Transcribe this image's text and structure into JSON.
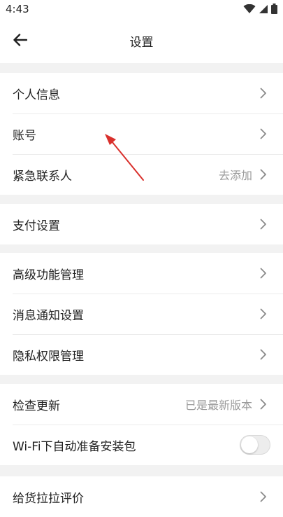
{
  "status_bar": {
    "time": "4:43",
    "icons": [
      "wifi-icon",
      "signal-icon",
      "battery-icon"
    ]
  },
  "header": {
    "title": "设置",
    "back_icon": "back-arrow-icon"
  },
  "groups": [
    {
      "items": [
        {
          "label": "个人信息",
          "value": "",
          "control": "chevron"
        },
        {
          "label": "账号",
          "value": "",
          "control": "chevron"
        },
        {
          "label": "紧急联系人",
          "value": "去添加",
          "control": "chevron"
        }
      ]
    },
    {
      "items": [
        {
          "label": "支付设置",
          "value": "",
          "control": "chevron"
        }
      ]
    },
    {
      "items": [
        {
          "label": "高级功能管理",
          "value": "",
          "control": "chevron"
        },
        {
          "label": "消息通知设置",
          "value": "",
          "control": "chevron"
        },
        {
          "label": "隐私权限管理",
          "value": "",
          "control": "chevron"
        }
      ]
    },
    {
      "items": [
        {
          "label": "检查更新",
          "value": "已是最新版本",
          "control": "chevron"
        },
        {
          "label": "Wi-Fi下自动准备安装包",
          "value": "",
          "control": "toggle",
          "toggle_on": false
        }
      ]
    },
    {
      "items": [
        {
          "label": "给货拉拉评价",
          "value": "",
          "control": "chevron"
        }
      ]
    }
  ],
  "annotation": {
    "type": "red-arrow",
    "color": "#d9302c",
    "points_to": "账号"
  },
  "colors": {
    "background": "#f2f2f2",
    "card": "#ffffff",
    "text": "#222222",
    "secondary_text": "#9a9a9a",
    "chevron": "#8a8a8a"
  }
}
